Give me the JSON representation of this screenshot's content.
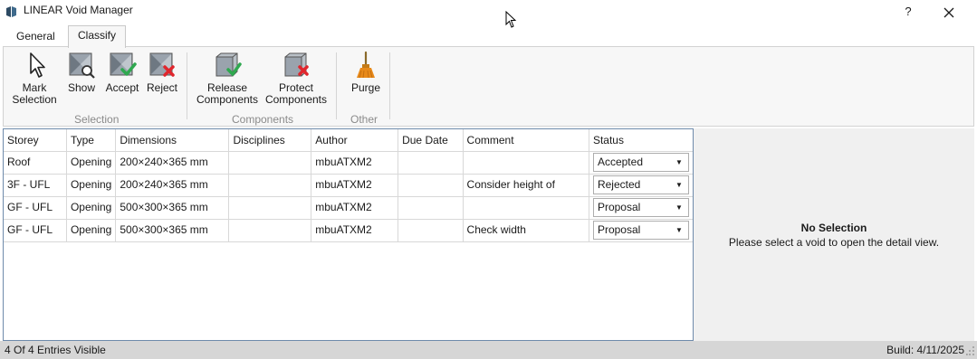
{
  "window": {
    "title": "LINEAR Void Manager",
    "help_label": "?"
  },
  "tabs": [
    {
      "label": "General",
      "active": false
    },
    {
      "label": "Classify",
      "active": true
    }
  ],
  "ribbon": {
    "groups": [
      {
        "label": "Selection",
        "buttons": [
          {
            "label": "Mark Selection",
            "icon": "cursor-arrow-icon"
          },
          {
            "label": "Show",
            "icon": "void-show-icon"
          },
          {
            "label": "Accept",
            "icon": "void-accept-icon"
          },
          {
            "label": "Reject",
            "icon": "void-reject-icon"
          }
        ]
      },
      {
        "label": "Components",
        "buttons": [
          {
            "label": "Release Components",
            "icon": "component-release-icon"
          },
          {
            "label": "Protect Components",
            "icon": "component-protect-icon"
          }
        ]
      },
      {
        "label": "Other",
        "buttons": [
          {
            "label": "Purge",
            "icon": "broom-icon"
          }
        ]
      }
    ]
  },
  "grid": {
    "columns": [
      "Storey",
      "Type",
      "Dimensions",
      "Disciplines",
      "Author",
      "Due Date",
      "Comment",
      "Status"
    ],
    "rows": [
      {
        "storey": "Roof",
        "type": "Opening",
        "dimensions": "200×240×365 mm",
        "disciplines": "",
        "author": "mbuATXM2",
        "due_date": "",
        "comment": "",
        "status": "Accepted"
      },
      {
        "storey": "3F - UFL",
        "type": "Opening",
        "dimensions": "200×240×365 mm",
        "disciplines": "",
        "author": "mbuATXM2",
        "due_date": "",
        "comment": "Consider height of",
        "status": "Rejected"
      },
      {
        "storey": "GF - UFL",
        "type": "Opening",
        "dimensions": "500×300×365 mm",
        "disciplines": "",
        "author": "mbuATXM2",
        "due_date": "",
        "comment": "",
        "status": "Proposal"
      },
      {
        "storey": "GF - UFL",
        "type": "Opening",
        "dimensions": "500×300×365 mm",
        "disciplines": "",
        "author": "mbuATXM2",
        "due_date": "",
        "comment": "Check width",
        "status": "Proposal"
      }
    ]
  },
  "detail": {
    "title": "No Selection",
    "message": "Please select a void to open the detail view."
  },
  "status": {
    "entries": "4 Of 4 Entries Visible",
    "build": "Build: 4/11/2025"
  },
  "colors": {
    "accept_green": "#2fa84f",
    "reject_red": "#e0262d",
    "purge_orange": "#e88a1a",
    "grid_border": "#6e8bab"
  }
}
